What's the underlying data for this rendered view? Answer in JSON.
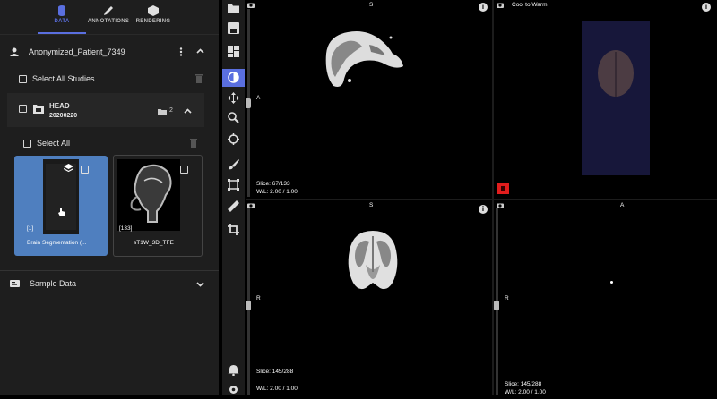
{
  "tabs": [
    {
      "label": "DATA",
      "icon": "database-icon",
      "active": true
    },
    {
      "label": "ANNOTATIONS",
      "icon": "pencil-icon",
      "active": false
    },
    {
      "label": "RENDERING",
      "icon": "cube-icon",
      "active": false
    }
  ],
  "patient": {
    "name": "Anonymized_Patient_7349",
    "icon": "person-icon"
  },
  "select_all_studies": "Select All Studies",
  "study": {
    "name": "HEAD",
    "date": "20200220",
    "series_count": "2"
  },
  "select_all": "Select All",
  "thumbnails": [
    {
      "count": "[1]",
      "label": "Brain Segmentation (...",
      "selected": true
    },
    {
      "count": "[133]",
      "label": "sT1W_3D_TFE",
      "selected": false
    }
  ],
  "sample_data": "Sample Data",
  "views": {
    "top_left": {
      "orientation": "S",
      "side": "A",
      "slice": "Slice: 67/133",
      "wl": "W/L: 2.00 / 1.00"
    },
    "top_right": {
      "preset": "Cool to Warm"
    },
    "bottom_left": {
      "orientation": "S",
      "side": "R",
      "slice": "Slice: 145/288",
      "wl": "W/L: 2.00 / 1.00"
    },
    "bottom_right": {
      "orientation": "A",
      "side": "R",
      "slice": "Slice: 145/288",
      "wl": "W/L: 2.00 / 1.00"
    }
  },
  "colors": {
    "accent": "#5a6fe0",
    "selected_thumb": "#4f7fbf",
    "panel": "#1e1e1e",
    "red_marker": "#e11d1d"
  }
}
